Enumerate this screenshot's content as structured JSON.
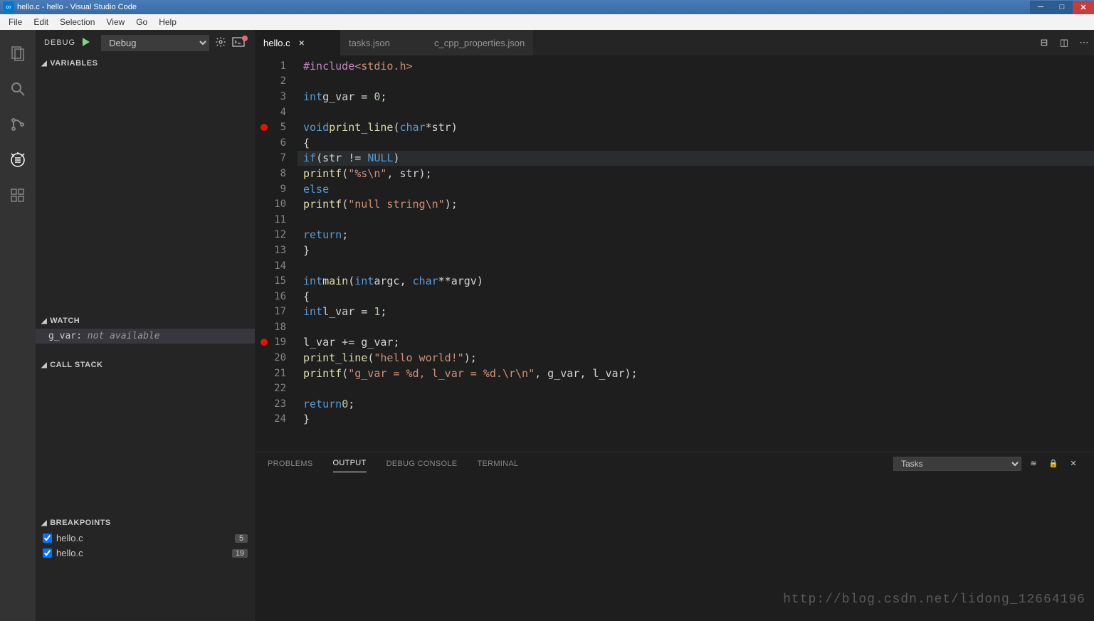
{
  "title": "hello.c - hello - Visual Studio Code",
  "menu": [
    "File",
    "Edit",
    "Selection",
    "View",
    "Go",
    "Help"
  ],
  "debug": {
    "label": "DEBUG",
    "config": "Debug"
  },
  "sections": {
    "variables": "VARIABLES",
    "watch": "WATCH",
    "callstack": "CALL STACK",
    "breakpoints": "BREAKPOINTS"
  },
  "watch_item": {
    "expr": "g_var:",
    "msg": "not available"
  },
  "breakpoints": [
    {
      "file": "hello.c",
      "line": "5"
    },
    {
      "file": "hello.c",
      "line": "19"
    }
  ],
  "tabs": [
    {
      "name": "hello.c",
      "active": true
    },
    {
      "name": "tasks.json",
      "active": false
    },
    {
      "name": "c_cpp_properties.json",
      "active": false
    }
  ],
  "code_lines": [
    {
      "n": 1,
      "bp": false,
      "hl": false,
      "html": "<span class='tok-inc'>#include</span> <span class='tok-incf'>&lt;stdio.h&gt;</span>"
    },
    {
      "n": 2,
      "bp": false,
      "hl": false,
      "html": ""
    },
    {
      "n": 3,
      "bp": false,
      "hl": false,
      "html": "<span class='tok-kw'>int</span> <span class='tok-pl'>g_var = </span><span class='tok-num'>0</span><span class='tok-pl'>;</span>"
    },
    {
      "n": 4,
      "bp": false,
      "hl": false,
      "html": ""
    },
    {
      "n": 5,
      "bp": true,
      "hl": false,
      "html": "<span class='tok-kw'>void</span> <span class='tok-fn'>print_line</span><span class='tok-pl'>(</span><span class='tok-kw'>char</span> <span class='tok-pl'>*str)</span>"
    },
    {
      "n": 6,
      "bp": false,
      "hl": false,
      "html": "<span class='tok-pl'>{</span>"
    },
    {
      "n": 7,
      "bp": false,
      "hl": true,
      "html": "    <span class='tok-kw'>if</span> <span class='tok-pl'>(str != </span><span class='tok-null'>NULL</span><span class='tok-pl'>)</span>"
    },
    {
      "n": 8,
      "bp": false,
      "hl": false,
      "html": "        <span class='tok-fn'>printf</span><span class='tok-pl'>(</span><span class='tok-str'>\"%s\\n\"</span><span class='tok-pl'>, str);</span>"
    },
    {
      "n": 9,
      "bp": false,
      "hl": false,
      "html": "    <span class='tok-kw'>else</span>"
    },
    {
      "n": 10,
      "bp": false,
      "hl": false,
      "html": "        <span class='tok-fn'>printf</span><span class='tok-pl'>(</span><span class='tok-str'>\"null string\\n\"</span><span class='tok-pl'>);</span>"
    },
    {
      "n": 11,
      "bp": false,
      "hl": false,
      "html": ""
    },
    {
      "n": 12,
      "bp": false,
      "hl": false,
      "html": "    <span class='tok-kw'>return</span><span class='tok-pl'>;</span>"
    },
    {
      "n": 13,
      "bp": false,
      "hl": false,
      "html": "<span class='tok-pl'>}</span>"
    },
    {
      "n": 14,
      "bp": false,
      "hl": false,
      "html": ""
    },
    {
      "n": 15,
      "bp": false,
      "hl": false,
      "html": "<span class='tok-kw'>int</span> <span class='tok-fn'>main</span> <span class='tok-pl'>(</span><span class='tok-kw'>int</span> <span class='tok-pl'>argc, </span><span class='tok-kw'>char</span> <span class='tok-pl'>**argv)</span>"
    },
    {
      "n": 16,
      "bp": false,
      "hl": false,
      "html": "<span class='tok-pl'>{</span>"
    },
    {
      "n": 17,
      "bp": false,
      "hl": false,
      "html": "    <span class='tok-kw'>int</span> <span class='tok-pl'>l_var = </span><span class='tok-num'>1</span><span class='tok-pl'>;</span>"
    },
    {
      "n": 18,
      "bp": false,
      "hl": false,
      "html": ""
    },
    {
      "n": 19,
      "bp": true,
      "hl": false,
      "html": "    <span class='tok-pl'>l_var += g_var;</span>"
    },
    {
      "n": 20,
      "bp": false,
      "hl": false,
      "html": "    <span class='tok-fn'>print_line</span><span class='tok-pl'>(</span><span class='tok-str'>\"hello world!\"</span><span class='tok-pl'>);</span>"
    },
    {
      "n": 21,
      "bp": false,
      "hl": false,
      "html": "    <span class='tok-fn'>printf</span><span class='tok-pl'>(</span><span class='tok-str'>\"g_var = %d, l_var = %d.\\r\\n\"</span><span class='tok-pl'>, g_var, l_var);</span>"
    },
    {
      "n": 22,
      "bp": false,
      "hl": false,
      "html": ""
    },
    {
      "n": 23,
      "bp": false,
      "hl": false,
      "html": "    <span class='tok-kw'>return</span> <span class='tok-num'>0</span><span class='tok-pl'>;</span>"
    },
    {
      "n": 24,
      "bp": false,
      "hl": false,
      "html": "<span class='tok-pl'>}</span>"
    }
  ],
  "panel_tabs": {
    "problems": "PROBLEMS",
    "output": "OUTPUT",
    "debug": "DEBUG CONSOLE",
    "terminal": "TERMINAL"
  },
  "panel_select": "Tasks",
  "watermark": "http://blog.csdn.net/lidong_12664196"
}
